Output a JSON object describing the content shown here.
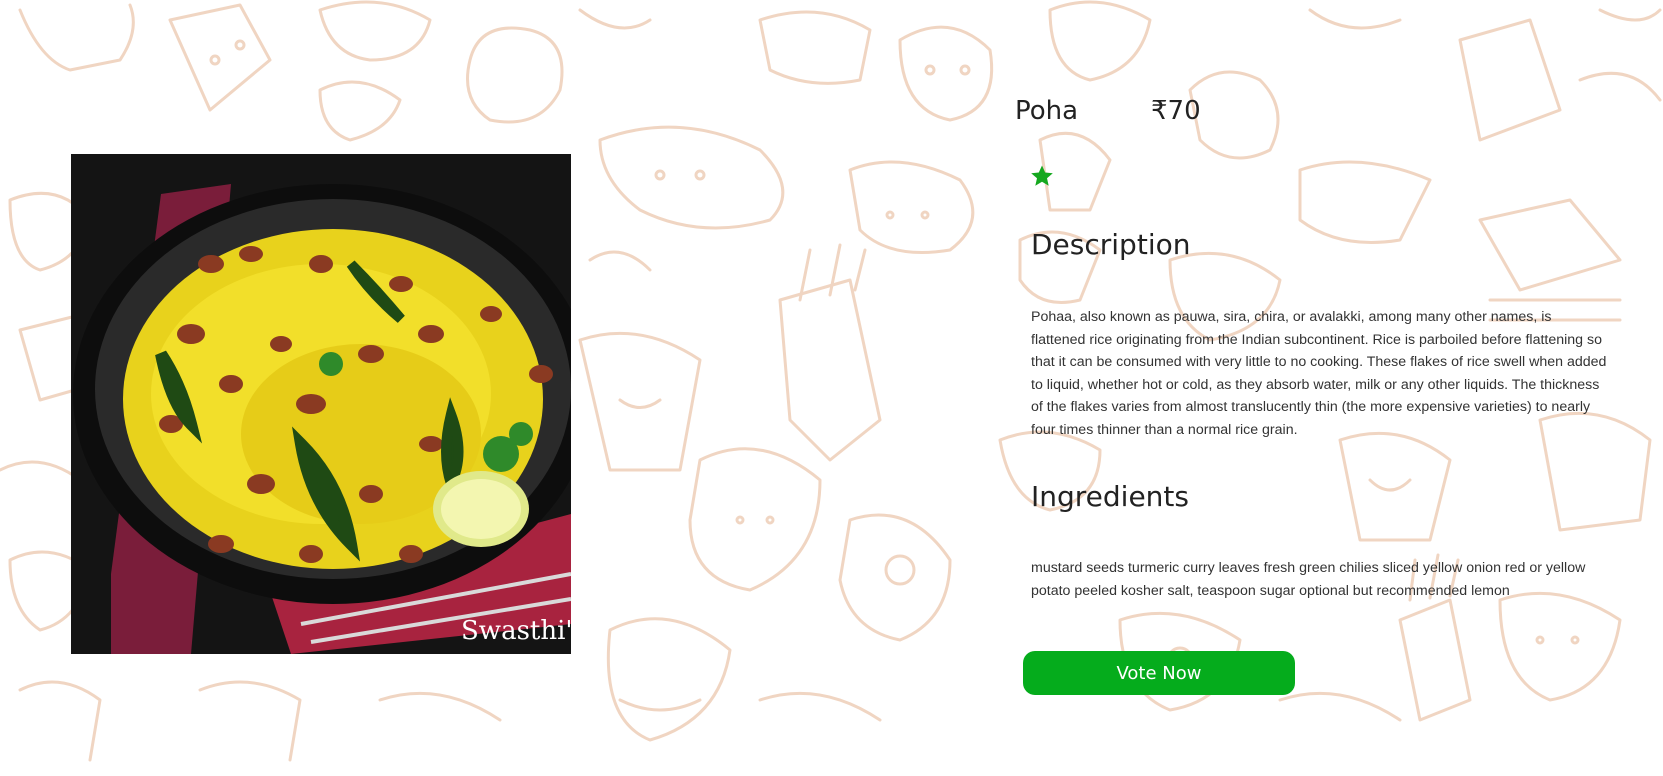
{
  "dish": {
    "name": "Poha",
    "price": "₹70",
    "rating_stars": 1,
    "image_alt": "Poha in a black bowl",
    "image_watermark": "Swasthi's R"
  },
  "description": {
    "heading": "Description",
    "text": "Pohaa, also known as pauwa, sira, chira, or avalakki, among many other names, is flattened rice originating from the Indian subcontinent. Rice is parboiled before flattening so that it can be consumed with very little to no cooking. These flakes of rice swell when added to liquid, whether hot or cold, as they absorb water, milk or any other liquids. The thickness of the flakes varies from almost translucently thin (the more expensive varieties) to nearly four times thinner than a normal rice grain."
  },
  "ingredients": {
    "heading": "Ingredients",
    "text": "mustard seeds turmeric curry leaves fresh green chilies sliced yellow onion red or yellow potato peeled kosher salt, teaspoon sugar optional but recommended lemon"
  },
  "actions": {
    "vote_label": "Vote Now"
  },
  "colors": {
    "accent": "#05ac1c",
    "star": "#15a81f",
    "pattern_line": "#f0d5c2"
  },
  "icons": {
    "rating": "star-icon"
  }
}
